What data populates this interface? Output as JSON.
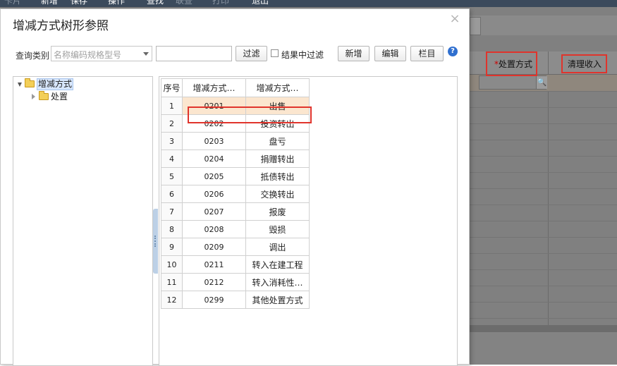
{
  "menubar": {
    "items": [
      {
        "label": "卡片",
        "disabled": true
      },
      {
        "label": "新增",
        "disabled": false
      },
      {
        "label": "保存",
        "disabled": false
      },
      {
        "label": "操作",
        "disabled": false
      },
      {
        "label": "查找",
        "disabled": false
      },
      {
        "label": "联查",
        "disabled": true
      },
      {
        "label": "打印",
        "disabled": true
      },
      {
        "label": "退出",
        "disabled": false
      }
    ]
  },
  "background_grid": {
    "columns": [
      {
        "label": "处置方式",
        "required": true
      },
      {
        "label": "清理收入",
        "required": false
      }
    ]
  },
  "dialog": {
    "title": "增减方式树形参照",
    "close_symbol": "×",
    "filter": {
      "label": "查询类别",
      "select_value": "名称编码规格型号",
      "input_value": "",
      "filter_button": "过滤",
      "checkbox_label": "结果中过滤",
      "checkbox_checked": false
    },
    "buttons": {
      "add": "新增",
      "edit": "编辑",
      "columns": "栏目",
      "help": "?"
    },
    "tree": {
      "root": "增减方式",
      "children": [
        "处置"
      ]
    },
    "table": {
      "headers": [
        "序号",
        "增减方式…",
        "增减方式…"
      ],
      "rows": [
        {
          "idx": "1",
          "code": "0201",
          "name": "出售"
        },
        {
          "idx": "2",
          "code": "0202",
          "name": "投资转出"
        },
        {
          "idx": "3",
          "code": "0203",
          "name": "盘亏"
        },
        {
          "idx": "4",
          "code": "0204",
          "name": "捐赠转出"
        },
        {
          "idx": "5",
          "code": "0205",
          "name": "抵债转出"
        },
        {
          "idx": "6",
          "code": "0206",
          "name": "交换转出"
        },
        {
          "idx": "7",
          "code": "0207",
          "name": "报废"
        },
        {
          "idx": "8",
          "code": "0208",
          "name": "毁损"
        },
        {
          "idx": "9",
          "code": "0209",
          "name": "调出"
        },
        {
          "idx": "10",
          "code": "0211",
          "name": "转入在建工程"
        },
        {
          "idx": "11",
          "code": "0212",
          "name": "转入消耗性…"
        },
        {
          "idx": "12",
          "code": "0299",
          "name": "其他处置方式"
        }
      ],
      "selected_index": 0
    }
  },
  "colors": {
    "highlight_box": "#e0342c",
    "selected_row": "#fbe6cf",
    "tree_selected": "#d7e6fb",
    "help_icon": "#2f6fcf",
    "folder": "#f3cf58"
  }
}
